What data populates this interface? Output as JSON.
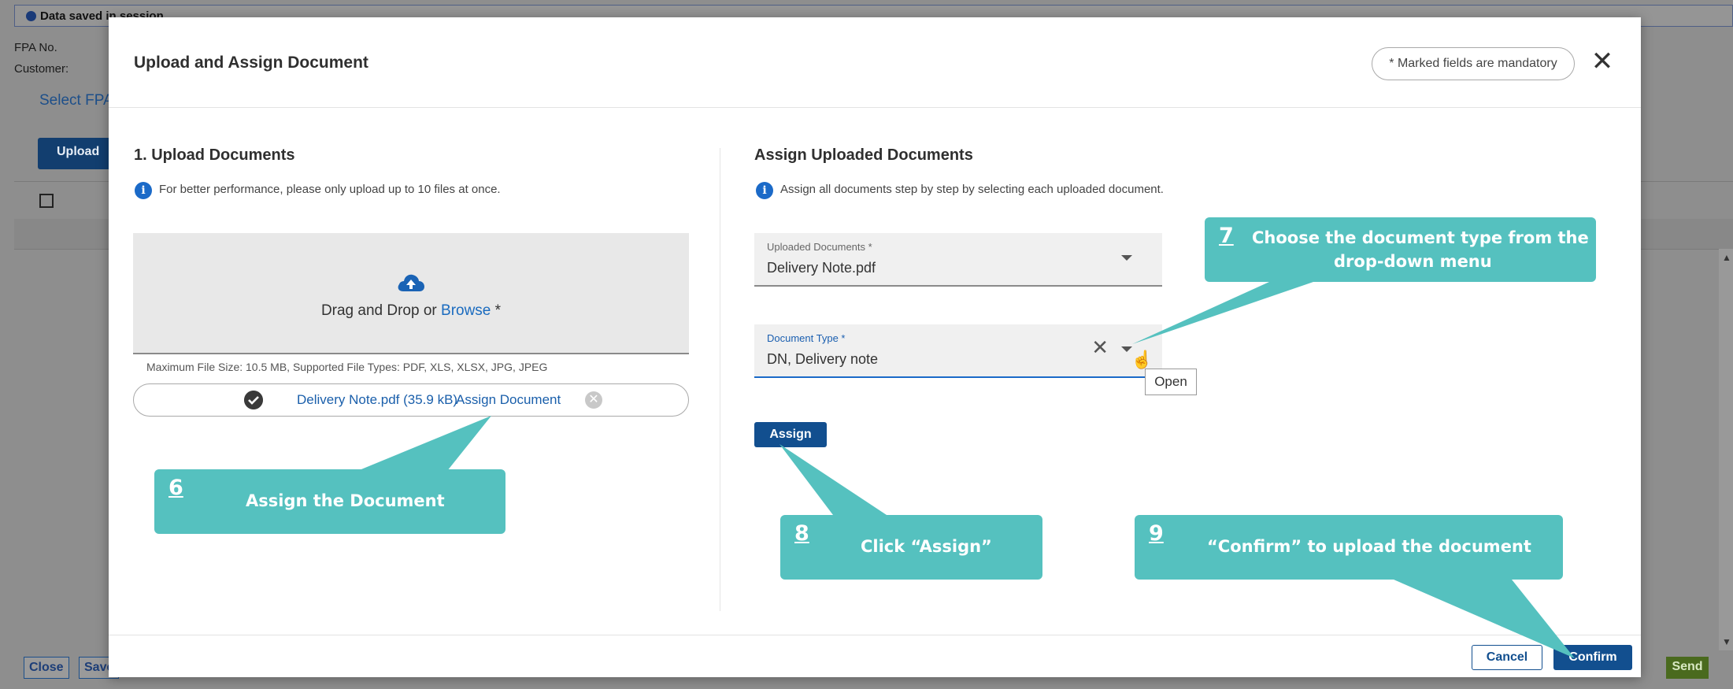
{
  "background": {
    "session_status": "Data saved in session",
    "fpa_label": "FPA No.",
    "customer_label": "Customer:",
    "select_link": "Select FPA",
    "upload_button": "Upload",
    "close_button": "Close",
    "save_button": "Save",
    "send_button": "Send"
  },
  "modal": {
    "title": "Upload and Assign Document",
    "mandatory_note": "* Marked fields are mandatory",
    "close_icon": "close-icon"
  },
  "upload": {
    "title": "1. Upload Documents",
    "info": "For better performance, please only upload up to 10 files at once.",
    "drop_text": "Drag and Drop or ",
    "browse_link": "Browse",
    "required_star": " *",
    "file_note": "Maximum File Size: 10.5 MB, Supported File Types: PDF, XLS, XLSX, JPG, JPEG",
    "file": {
      "name": "Delivery Note.pdf (35.9 kB)",
      "action": "Assign Document"
    }
  },
  "assign": {
    "title": "Assign Uploaded Documents",
    "info": "Assign all documents step by step by selecting each uploaded document.",
    "uploaded_docs_label": "Uploaded Documents *",
    "uploaded_docs_value": "Delivery Note.pdf",
    "doc_type_label": "Document Type *",
    "doc_type_value": "DN, Delivery note",
    "tooltip": "Open",
    "assign_button": "Assign"
  },
  "footer": {
    "cancel": "Cancel",
    "confirm": "Confirm"
  },
  "callouts": {
    "step6": {
      "num": "6",
      "text": "Assign the Document"
    },
    "step7": {
      "num": "7",
      "text_line1": "Choose the document type from the",
      "text_line2": "drop-down menu"
    },
    "step8": {
      "num": "8",
      "text": "Click “Assign”"
    },
    "step9": {
      "num": "9",
      "text": "“Confirm” to upload the document"
    }
  },
  "colors": {
    "accent": "#124f8f",
    "callout": "#55c1bf",
    "link": "#1a6bbf"
  }
}
